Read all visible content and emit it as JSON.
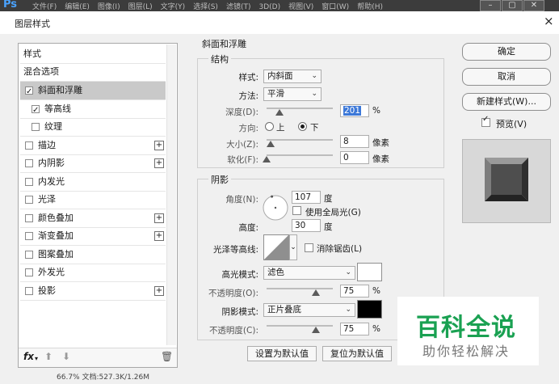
{
  "app": {
    "logo": "Ps",
    "menu": [
      "文件(F)",
      "编辑(E)",
      "图像(I)",
      "图层(L)",
      "文字(Y)",
      "选择(S)",
      "滤镜(T)",
      "3D(D)",
      "视图(V)",
      "窗口(W)",
      "帮助(H)"
    ]
  },
  "dialog": {
    "title": "图层样式",
    "close": "×"
  },
  "sidebar": {
    "header": "样式",
    "blend_options": "混合选项",
    "items": [
      {
        "label": "斜面和浮雕",
        "checked": true,
        "selected": true,
        "plus": false
      },
      {
        "label": "等高线",
        "checked": true,
        "sub": true
      },
      {
        "label": "纹理",
        "checked": false,
        "sub": true
      },
      {
        "label": "描边",
        "checked": false,
        "plus": true
      },
      {
        "label": "内阴影",
        "checked": false,
        "plus": true
      },
      {
        "label": "内发光",
        "checked": false
      },
      {
        "label": "光泽",
        "checked": false
      },
      {
        "label": "颜色叠加",
        "checked": false,
        "plus": true
      },
      {
        "label": "渐变叠加",
        "checked": false,
        "plus": true
      },
      {
        "label": "图案叠加",
        "checked": false
      },
      {
        "label": "外发光",
        "checked": false
      },
      {
        "label": "投影",
        "checked": false,
        "plus": true
      }
    ],
    "fx_label": "fx"
  },
  "bevel": {
    "title": "斜面和浮雕",
    "structure": {
      "title": "结构",
      "style_label": "样式:",
      "style_value": "内斜面",
      "technique_label": "方法:",
      "technique_value": "平滑",
      "depth_label": "深度(D):",
      "depth_value": "201",
      "depth_unit": "%",
      "direction_label": "方向:",
      "dir_up": "上",
      "dir_down": "下",
      "size_label": "大小(Z):",
      "size_value": "8",
      "size_unit": "像素",
      "soften_label": "软化(F):",
      "soften_value": "0",
      "soften_unit": "像素"
    },
    "shading": {
      "title": "阴影",
      "angle_label": "角度(N):",
      "angle_value": "107",
      "angle_unit": "度",
      "global_light": "使用全局光(G)",
      "altitude_label": "高度:",
      "altitude_value": "30",
      "altitude_unit": "度",
      "gloss_label": "光泽等高线:",
      "anti_alias": "消除锯齿(L)",
      "highlight_label": "高光模式:",
      "highlight_value": "滤色",
      "highlight_color": "#ffffff",
      "hl_opacity_label": "不透明度(O):",
      "hl_opacity_value": "75",
      "hl_opacity_unit": "%",
      "shadow_label": "阴影模式:",
      "shadow_value": "正片叠底",
      "shadow_color": "#000000",
      "sh_opacity_label": "不透明度(C):",
      "sh_opacity_value": "75",
      "sh_opacity_unit": "%"
    },
    "make_default": "设置为默认值",
    "reset_default": "复位为默认值"
  },
  "buttons": {
    "ok": "确定",
    "cancel": "取消",
    "new_style": "新建样式(W)...",
    "preview": "预览(V)"
  },
  "watermark": {
    "big": "百科全说",
    "small": "助你轻松解决"
  },
  "status": {
    "text": "66.7% 文档:527.3K/1.26M"
  }
}
